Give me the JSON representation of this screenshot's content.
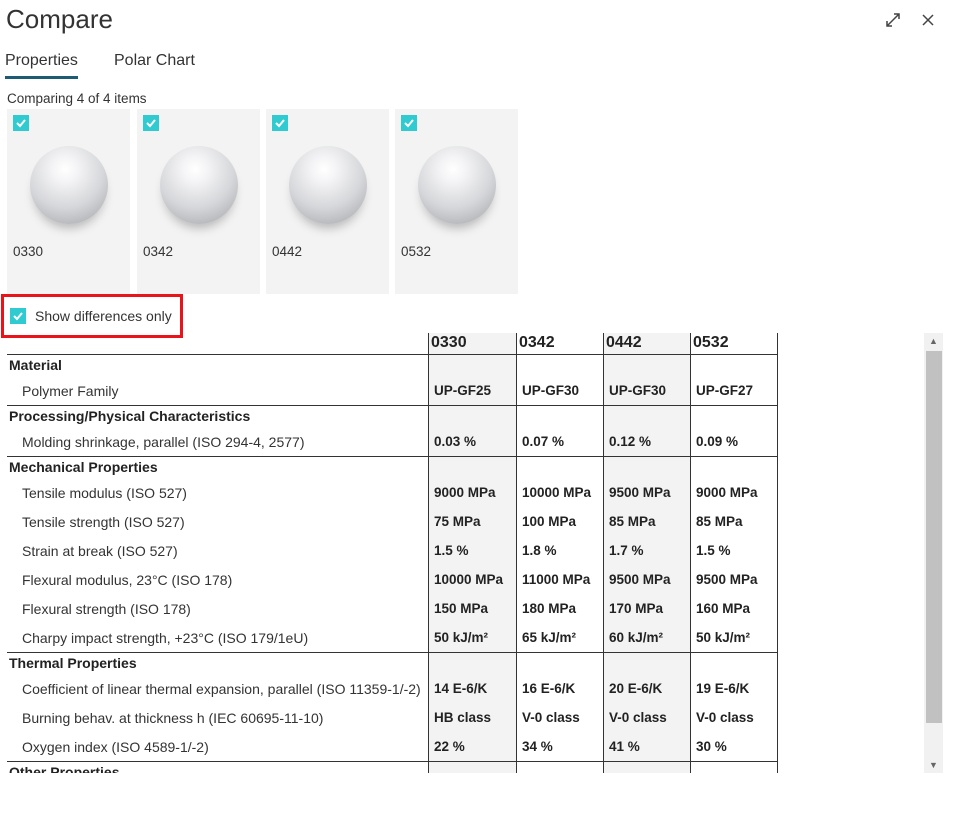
{
  "title": "Compare",
  "tabs": [
    {
      "label": "Properties",
      "active": true
    },
    {
      "label": "Polar Chart",
      "active": false
    }
  ],
  "comparing": "Comparing 4 of 4 items",
  "items": [
    {
      "id": "0330",
      "checked": true
    },
    {
      "id": "0342",
      "checked": true
    },
    {
      "id": "0442",
      "checked": true
    },
    {
      "id": "0532",
      "checked": true
    }
  ],
  "show_differences": {
    "label": "Show differences only",
    "checked": true
  },
  "accent": "#2fcbd0",
  "table": {
    "columns": [
      "0330",
      "0342",
      "0442",
      "0532"
    ],
    "groups": [
      {
        "name": "Material",
        "rows": [
          {
            "label": "Polymer Family",
            "values": [
              "UP-GF25",
              "UP-GF30",
              "UP-GF30",
              "UP-GF27"
            ]
          }
        ]
      },
      {
        "name": "Processing/Physical Characteristics",
        "rows": [
          {
            "label": "Molding shrinkage, parallel (ISO 294-4, 2577)",
            "values": [
              "0.03 %",
              "0.07 %",
              "0.12 %",
              "0.09 %"
            ]
          }
        ]
      },
      {
        "name": "Mechanical Properties",
        "rows": [
          {
            "label": "Tensile modulus (ISO 527)",
            "values": [
              "9000 MPa",
              "10000 MPa",
              "9500 MPa",
              "9000 MPa"
            ]
          },
          {
            "label": "Tensile strength (ISO 527)",
            "values": [
              "75 MPa",
              "100 MPa",
              "85 MPa",
              "85 MPa"
            ]
          },
          {
            "label": "Strain at break (ISO 527)",
            "values": [
              "1.5 %",
              "1.8 %",
              "1.7 %",
              "1.5 %"
            ]
          },
          {
            "label": "Flexural modulus, 23°C (ISO 178)",
            "values": [
              "10000 MPa",
              "11000 MPa",
              "9500 MPa",
              "9500 MPa"
            ]
          },
          {
            "label": "Flexural strength (ISO 178)",
            "values": [
              "150 MPa",
              "180 MPa",
              "170 MPa",
              "160 MPa"
            ]
          },
          {
            "label": "Charpy impact strength, +23°C (ISO 179/1eU)",
            "values": [
              "50 kJ/m²",
              "65 kJ/m²",
              "60 kJ/m²",
              "50 kJ/m²"
            ]
          }
        ]
      },
      {
        "name": "Thermal Properties",
        "rows": [
          {
            "label": "Coefficient of linear thermal expansion, parallel (ISO 11359-1/-2)",
            "values": [
              "14 E-6/K",
              "16 E-6/K",
              "20 E-6/K",
              "19 E-6/K"
            ]
          },
          {
            "label": "Burning behav. at thickness h (IEC 60695-11-10)",
            "values": [
              "HB class",
              "V-0 class",
              "V-0 class",
              "V-0 class"
            ]
          },
          {
            "label": "Oxygen index (ISO 4589-1/-2)",
            "values": [
              "22 %",
              "34 %",
              "41 %",
              "30 %"
            ]
          }
        ]
      },
      {
        "name": "Other Properties",
        "rows": []
      }
    ]
  }
}
